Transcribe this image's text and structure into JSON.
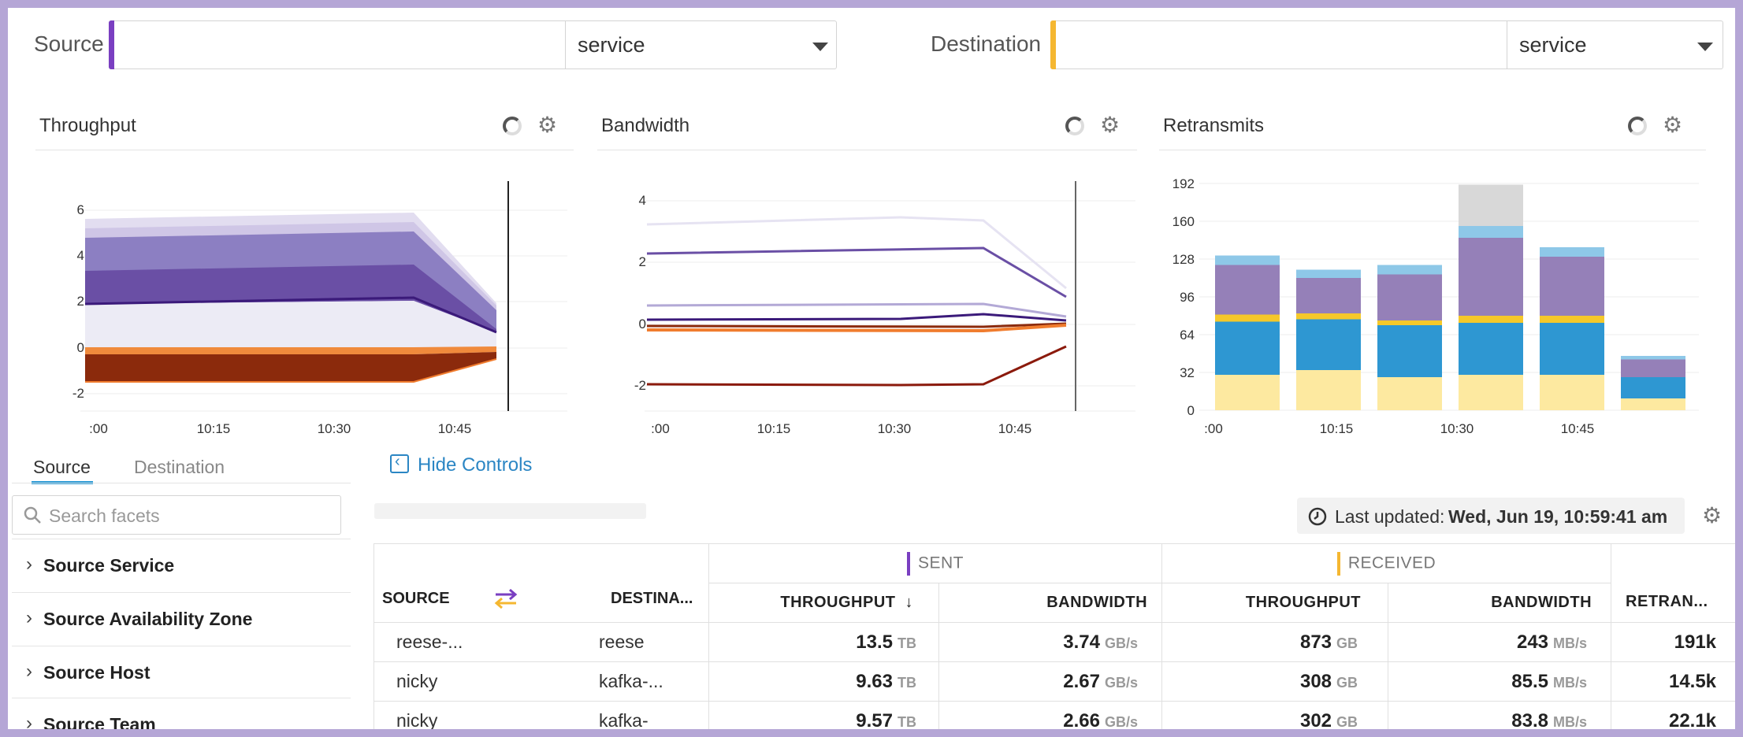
{
  "filters": {
    "source_label": "Source",
    "source_group_by": "service",
    "destination_label": "Destination",
    "destination_group_by": "service",
    "source_color": "#7a3fc1",
    "destination_color": "#f5b731"
  },
  "widgets": {
    "throughput": {
      "title": "Throughput"
    },
    "bandwidth": {
      "title": "Bandwidth"
    },
    "retransmits": {
      "title": "Retransmits"
    }
  },
  "chart_data": [
    {
      "type": "area",
      "title": "Throughput",
      "x": [
        ":00",
        "10:15",
        "10:30",
        "10:45"
      ],
      "y_ticks": [
        "6",
        "4",
        "2",
        "0",
        "-2"
      ],
      "ylim": [
        -2.5,
        7
      ]
    },
    {
      "type": "line",
      "title": "Bandwidth",
      "x": [
        ":00",
        "10:15",
        "10:30",
        "10:45"
      ],
      "y_ticks": [
        "4",
        "2",
        "0",
        "-2"
      ],
      "ylim": [
        -2.8,
        4.5
      ]
    },
    {
      "type": "bar",
      "title": "Retransmits",
      "x": [
        ":00",
        "10:15",
        "10:30",
        "10:45"
      ],
      "y_ticks": [
        "192",
        "160",
        "128",
        "96",
        "64",
        "32",
        "0"
      ],
      "ylim": [
        0,
        192
      ],
      "series_colors": [
        "#fde9a0",
        "#2e97d2",
        "#f5c82a",
        "#9580b8",
        "#8ec8e8",
        "#d8d8d8"
      ],
      "series": [
        {
          "values": [
            30,
            34,
            28,
            30,
            30,
            10
          ]
        },
        {
          "values": [
            45,
            43,
            44,
            44,
            44,
            18
          ]
        },
        {
          "values": [
            6,
            5,
            4,
            6,
            6,
            0
          ]
        },
        {
          "values": [
            42,
            30,
            39,
            66,
            50,
            15
          ]
        },
        {
          "values": [
            8,
            7,
            8,
            10,
            8,
            3
          ]
        },
        {
          "values": [
            0,
            0,
            0,
            35,
            0,
            0
          ]
        }
      ]
    }
  ],
  "facets": {
    "tabs": [
      "Source",
      "Destination"
    ],
    "search_placeholder": "Search facets",
    "items": [
      "Source Service",
      "Source Availability Zone",
      "Source Host",
      "Source Team"
    ]
  },
  "controls": {
    "hide_label": "Hide Controls",
    "last_updated_label": "Last updated:",
    "last_updated_value": "Wed, Jun 19, 10:59:41 am"
  },
  "table": {
    "group_sent": "SENT",
    "group_received": "RECEIVED",
    "headers": {
      "source": "SOURCE",
      "destination": "DESTINA...",
      "sent_throughput": "THROUGHPUT",
      "sent_bandwidth": "BANDWIDTH",
      "recv_throughput": "THROUGHPUT",
      "recv_bandwidth": "BANDWIDTH",
      "retransmits": "RETRAN..."
    },
    "rows": [
      {
        "source": "reese-...",
        "destination": "reese",
        "st": "13.5",
        "stu": "TB",
        "sb": "3.74",
        "sbu": "GB/s",
        "rt": "873",
        "rtu": "GB",
        "rb": "243",
        "rbu": "MB/s",
        "retr": "191k"
      },
      {
        "source": "nicky",
        "destination": "kafka-...",
        "st": "9.63",
        "stu": "TB",
        "sb": "2.67",
        "sbu": "GB/s",
        "rt": "308",
        "rtu": "GB",
        "rb": "85.5",
        "rbu": "MB/s",
        "retr": "14.5k"
      },
      {
        "source": "nicky",
        "destination": "kafka-",
        "st": "9.57",
        "stu": "TB",
        "sb": "2.66",
        "sbu": "GB/s",
        "rt": "302",
        "rtu": "GB",
        "rb": "83.8",
        "rbu": "MB/s",
        "retr": "22.1k"
      }
    ]
  }
}
